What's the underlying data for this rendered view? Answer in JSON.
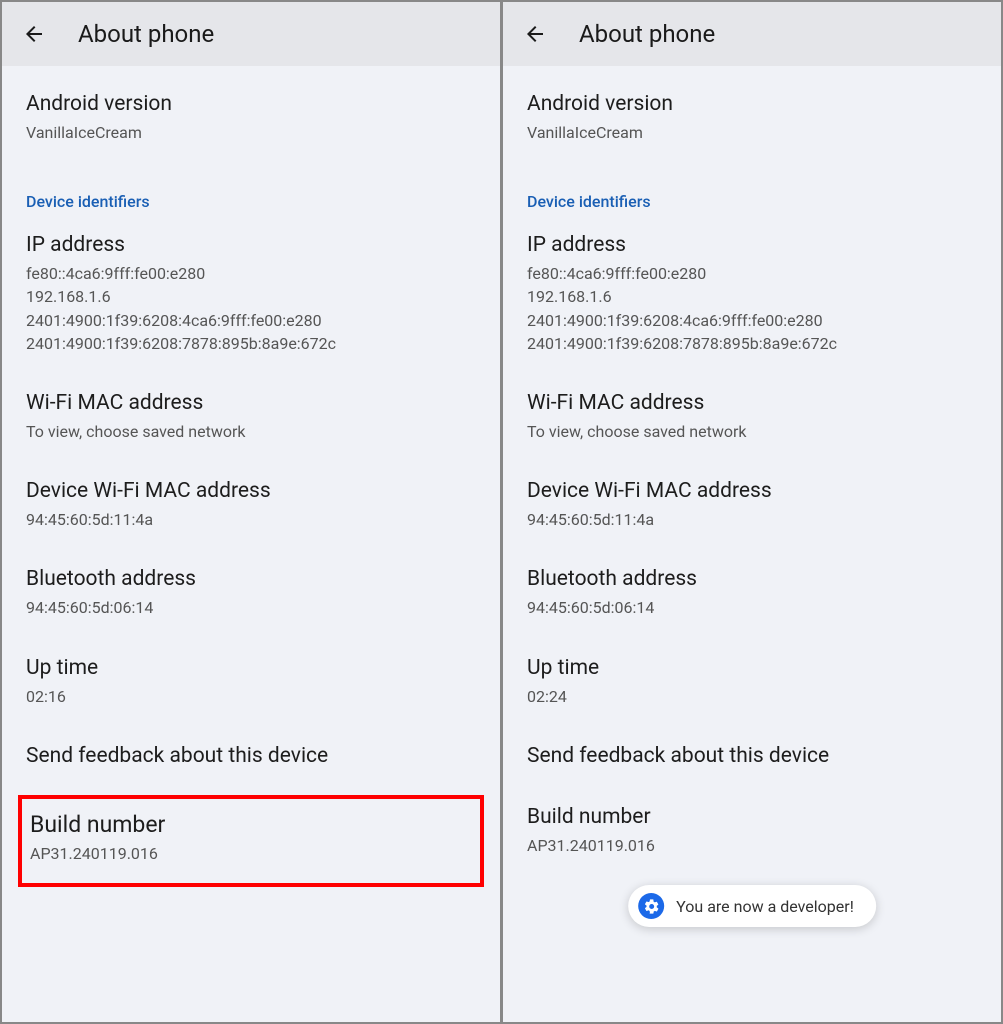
{
  "left": {
    "page_title": "About phone",
    "android_version": {
      "label": "Android version",
      "value": "VanillaIceCream"
    },
    "device_identifiers_header": "Device identifiers",
    "ip_address": {
      "label": "IP address",
      "value": "fe80::4ca6:9fff:fe00:e280\n192.168.1.6\n2401:4900:1f39:6208:4ca6:9fff:fe00:e280\n2401:4900:1f39:6208:7878:895b:8a9e:672c"
    },
    "wifi_mac": {
      "label": "Wi-Fi MAC address",
      "value": "To view, choose saved network"
    },
    "device_wifi_mac": {
      "label": "Device Wi-Fi MAC address",
      "value": "94:45:60:5d:11:4a"
    },
    "bluetooth": {
      "label": "Bluetooth address",
      "value": "94:45:60:5d:06:14"
    },
    "uptime": {
      "label": "Up time",
      "value": "02:16"
    },
    "feedback": {
      "label": "Send feedback about this device"
    },
    "build": {
      "label": "Build number",
      "value": "AP31.240119.016"
    }
  },
  "right": {
    "page_title": "About phone",
    "android_version": {
      "label": "Android version",
      "value": "VanillaIceCream"
    },
    "device_identifiers_header": "Device identifiers",
    "ip_address": {
      "label": "IP address",
      "value": "fe80::4ca6:9fff:fe00:e280\n192.168.1.6\n2401:4900:1f39:6208:4ca6:9fff:fe00:e280\n2401:4900:1f39:6208:7878:895b:8a9e:672c"
    },
    "wifi_mac": {
      "label": "Wi-Fi MAC address",
      "value": "To view, choose saved network"
    },
    "device_wifi_mac": {
      "label": "Device Wi-Fi MAC address",
      "value": "94:45:60:5d:11:4a"
    },
    "bluetooth": {
      "label": "Bluetooth address",
      "value": "94:45:60:5d:06:14"
    },
    "uptime": {
      "label": "Up time",
      "value": "02:24"
    },
    "feedback": {
      "label": "Send feedback about this device"
    },
    "build": {
      "label": "Build number",
      "value": "AP31.240119.016"
    },
    "toast": "You are now a developer!"
  }
}
